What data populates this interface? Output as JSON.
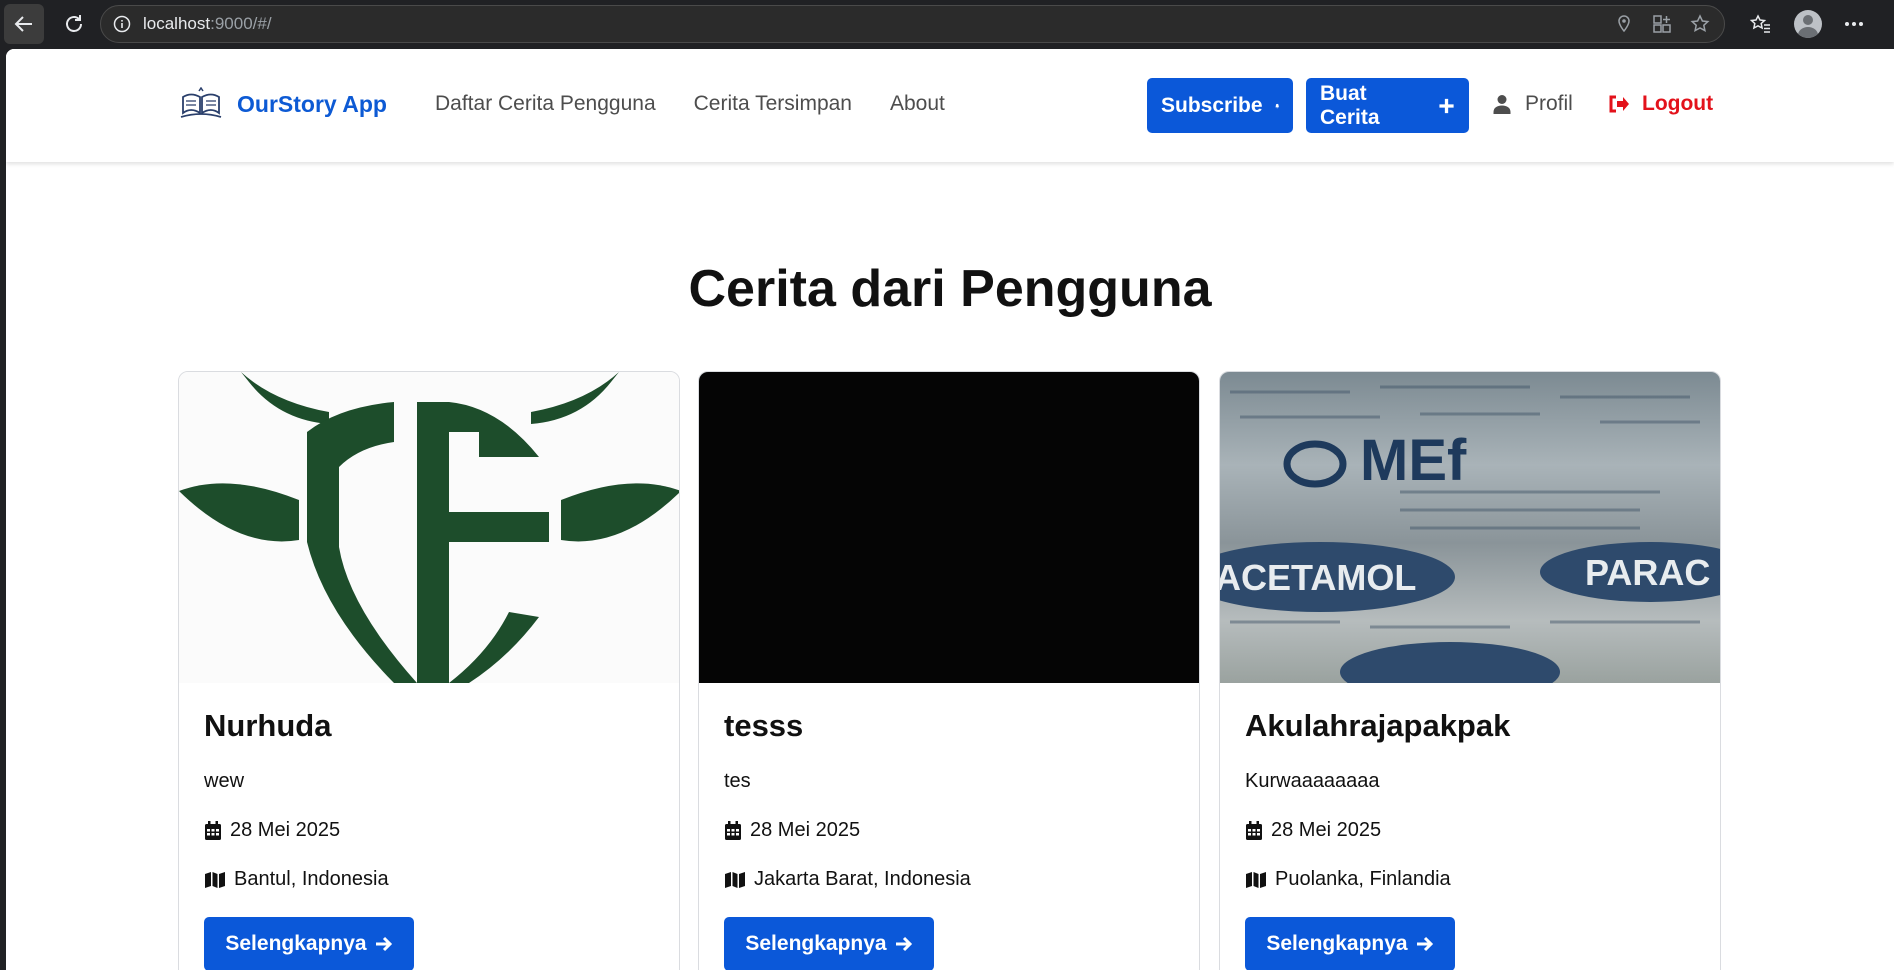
{
  "browser": {
    "url_host": "localhost",
    "url_rest": ":9000/#/"
  },
  "navbar": {
    "brand": "OurStory App",
    "links": [
      "Daftar Cerita Pengguna",
      "Cerita Tersimpan",
      "About"
    ],
    "subscribe_label": "Subscribe",
    "create_label": "Buat Cerita",
    "profile_label": "Profil",
    "logout_label": "Logout"
  },
  "colors": {
    "accent": "#0b58d9",
    "brand": "#0d5ad4",
    "logout": "#e3121b",
    "logo_green": "#1d4d2b"
  },
  "main": {
    "title": "Cerita dari Pengguna",
    "stories": [
      {
        "name": "Nurhuda",
        "description": "wew",
        "date": "28 Mei 2025",
        "location": "Bantul, Indonesia",
        "button": "Selengkapnya"
      },
      {
        "name": "tesss",
        "description": "tes",
        "date": "28 Mei 2025",
        "location": "Jakarta Barat, Indonesia",
        "button": "Selengkapnya"
      },
      {
        "name": "Akulahrajapakpak",
        "description": "Kurwaaaaaaaa",
        "date": "28 Mei 2025",
        "location": "Puolanka, Finlandia",
        "button": "Selengkapnya"
      }
    ]
  },
  "photo_text": {
    "brand": "MEf",
    "word_1": "ACETAMOL",
    "word_2": "PARAC"
  }
}
